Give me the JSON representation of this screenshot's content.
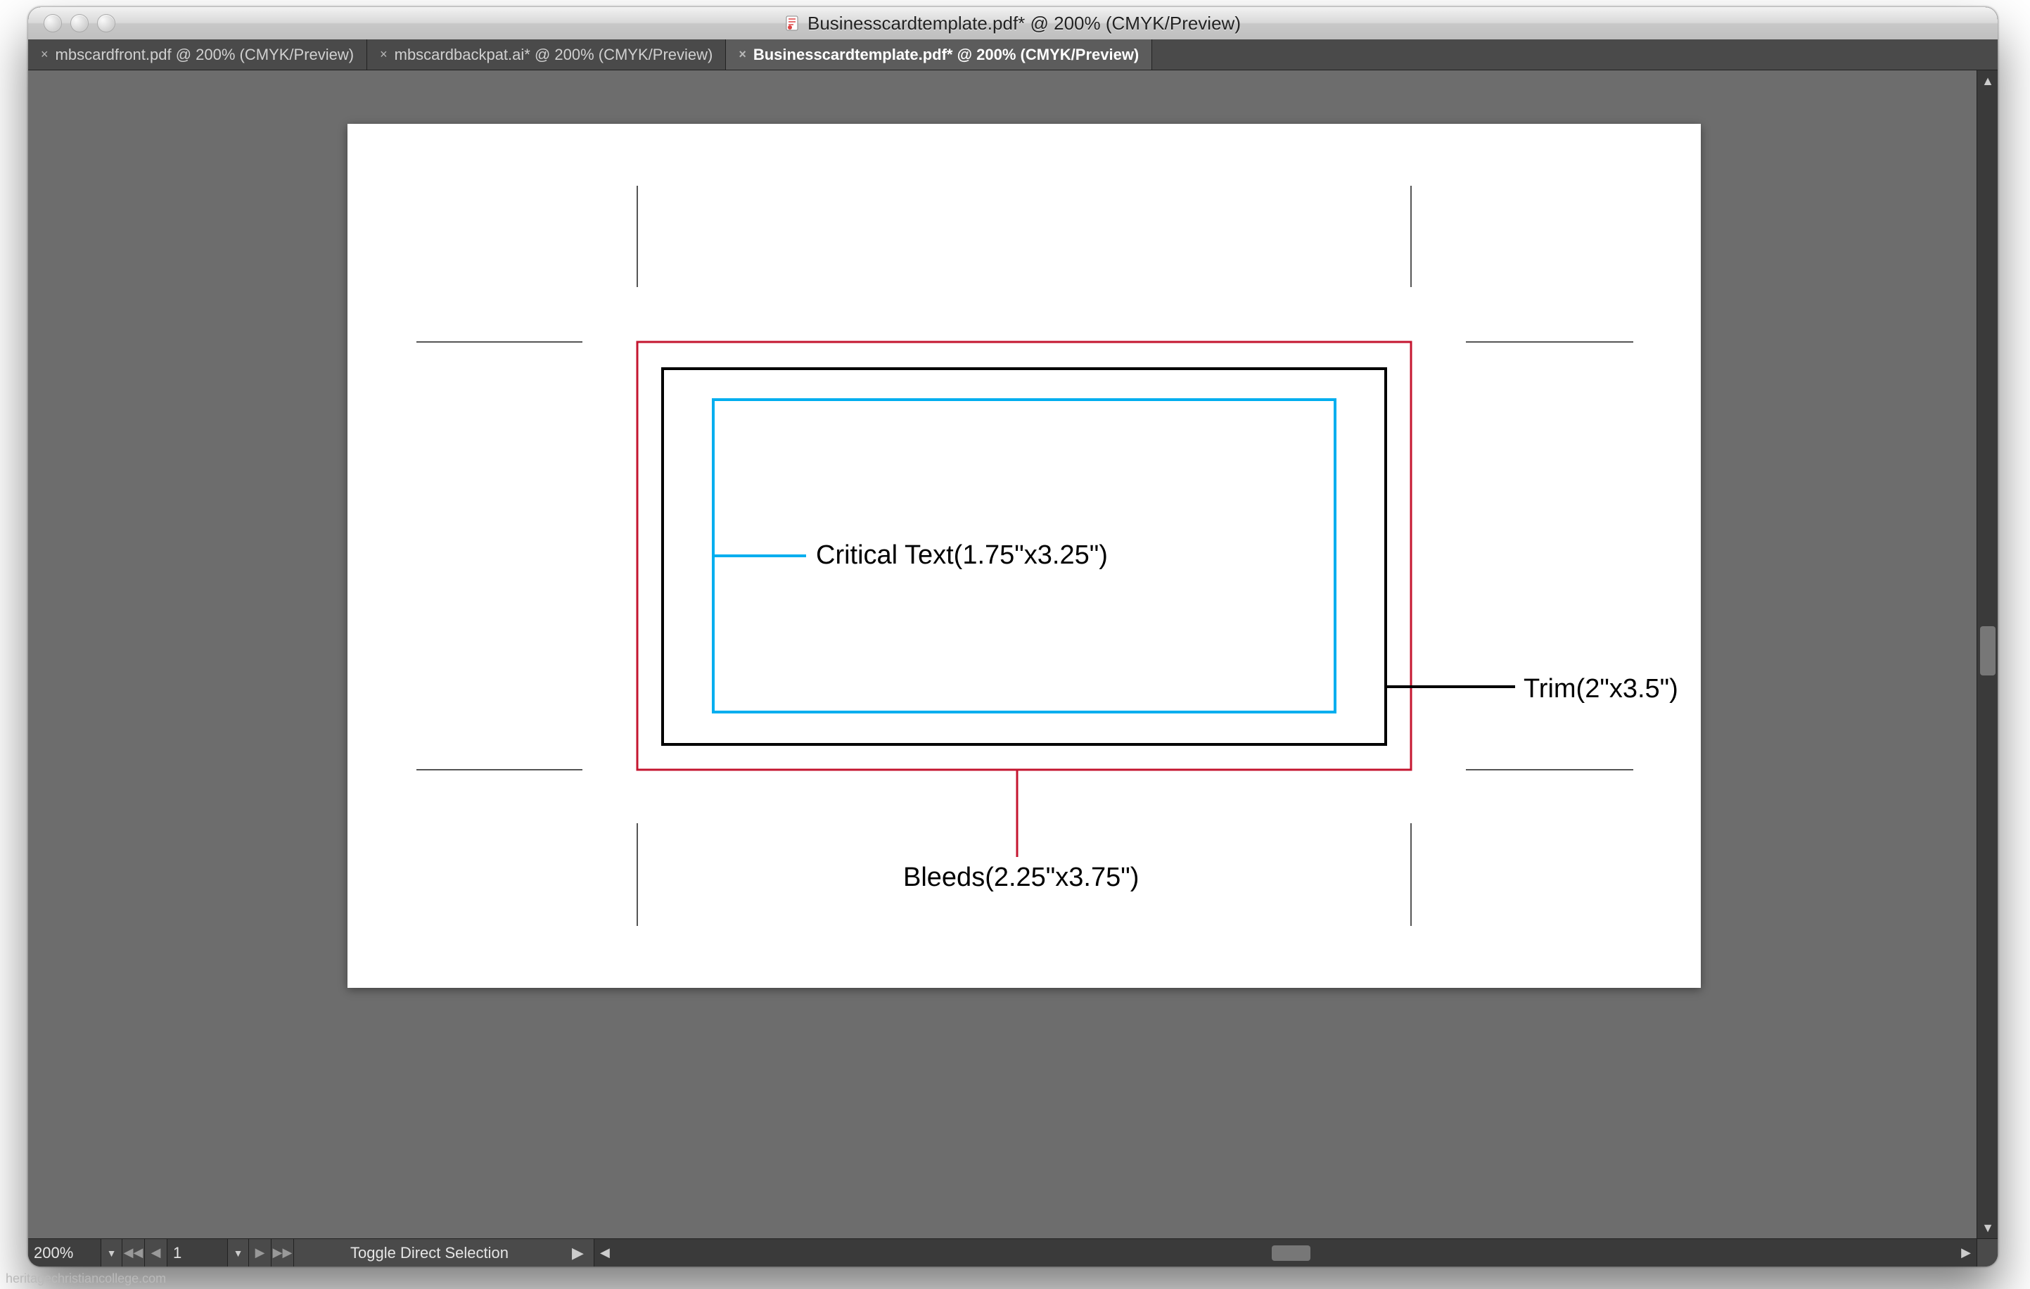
{
  "window": {
    "title": "Businesscardtemplate.pdf* @ 200% (CMYK/Preview)"
  },
  "tabs": [
    {
      "label": "mbscardfront.pdf @ 200% (CMYK/Preview)",
      "active": false
    },
    {
      "label": "mbscardbackpat.ai* @ 200% (CMYK/Preview)",
      "active": false
    },
    {
      "label": "Businesscardtemplate.pdf* @ 200% (CMYK/Preview)",
      "active": true
    }
  ],
  "statusbar": {
    "zoom": "200%",
    "page": "1",
    "hint": "Toggle Direct Selection"
  },
  "diagram": {
    "critical_text_label": "Critical Text(1.75\"x3.25\")",
    "trim_label": "Trim(2\"x3.5\")",
    "bleeds_label": "Bleeds(2.25\"x3.75\")",
    "colors": {
      "bleed": "#c4152f",
      "trim": "#000000",
      "critical": "#00aeef"
    }
  },
  "watermark": "heritagechristiancollege.com"
}
